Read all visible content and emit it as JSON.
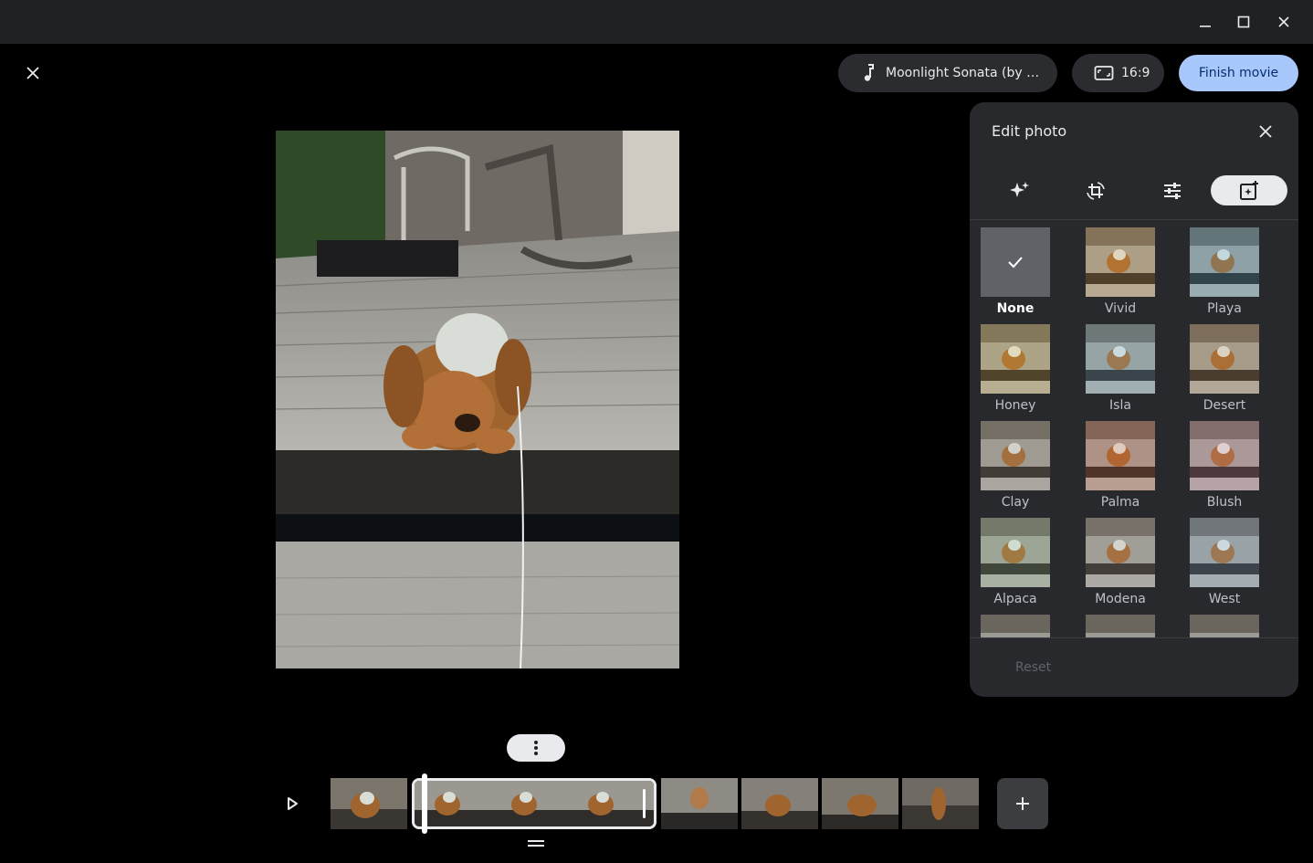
{
  "window": {
    "minimize_icon": "minimize-icon",
    "maximize_icon": "maximize-icon",
    "close_icon": "close-icon"
  },
  "toolbar": {
    "music_label": "Moonlight Sonata (by Be…",
    "aspect_ratio_label": "16:9",
    "finish_label": "Finish movie"
  },
  "panel": {
    "title": "Edit photo",
    "tabs": [
      {
        "name": "auto-enhance",
        "icon": "sparkle-icon",
        "active": false
      },
      {
        "name": "crop-rotate",
        "icon": "crop-rotate-icon",
        "active": false
      },
      {
        "name": "adjust",
        "icon": "sliders-icon",
        "active": false
      },
      {
        "name": "filters",
        "icon": "filter-icon",
        "active": true
      }
    ],
    "filters": [
      {
        "label": "None",
        "selected": true
      },
      {
        "label": "Vivid"
      },
      {
        "label": "Playa"
      },
      {
        "label": "Honey"
      },
      {
        "label": "Isla"
      },
      {
        "label": "Desert"
      },
      {
        "label": "Clay"
      },
      {
        "label": "Palma"
      },
      {
        "label": "Blush"
      },
      {
        "label": "Alpaca"
      },
      {
        "label": "Modena"
      },
      {
        "label": "West"
      }
    ],
    "reset_label": "Reset"
  },
  "colors": {
    "accent": "#a8c7fa",
    "panel_bg": "#28292c",
    "titlebar_bg": "#202124"
  }
}
